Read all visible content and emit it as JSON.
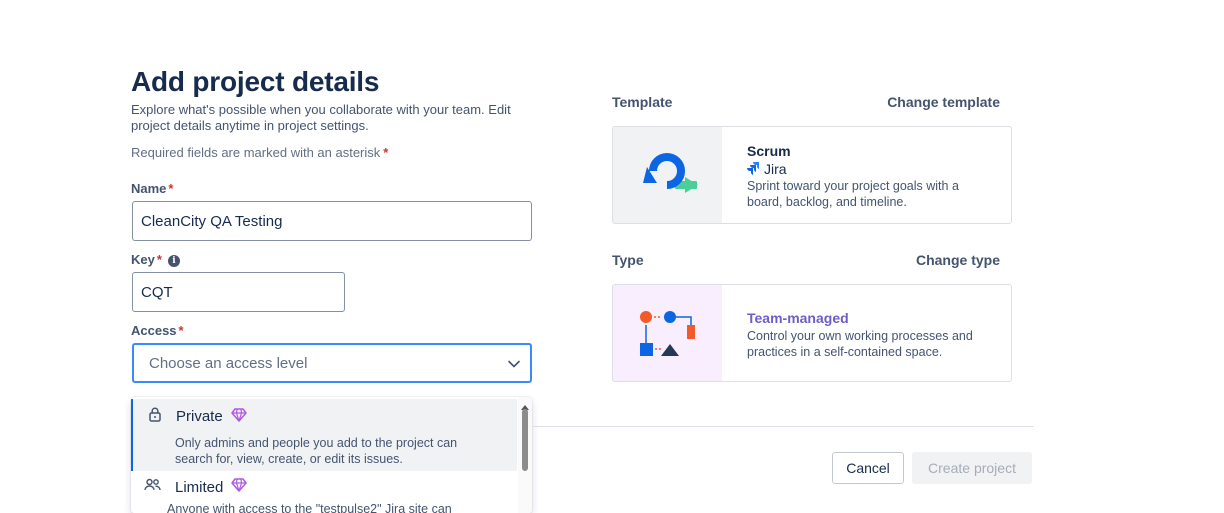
{
  "page": {
    "title": "Add project details",
    "description": "Explore what's possible when you collaborate with your team. Edit project details anytime in project settings.",
    "required_note": "Required fields are marked with an asterisk",
    "asterisk": "*"
  },
  "form": {
    "name": {
      "label": "Name",
      "value": "CleanCity QA Testing"
    },
    "key": {
      "label": "Key",
      "value": "CQT",
      "info_icon": "info-icon"
    },
    "access": {
      "label": "Access",
      "placeholder": "Choose an access level",
      "options": [
        {
          "title": "Private",
          "description": "Only admins and people you add to the project can search for, view, create, or edit its issues.",
          "icon": "lock-icon",
          "badge_icon": "premium-gem-icon"
        },
        {
          "title": "Limited",
          "description": "Anyone with access to the \"testpulse2\" Jira site can",
          "icon": "people-icon",
          "badge_icon": "premium-gem-icon"
        }
      ]
    }
  },
  "template": {
    "section_label": "Template",
    "change_label": "Change template",
    "name": "Scrum",
    "product": "Jira",
    "description": "Sprint toward your project goals with a board, backlog, and timeline."
  },
  "type": {
    "section_label": "Type",
    "change_label": "Change type",
    "name": "Team-managed",
    "description": "Control your own working processes and practices in a self-contained space."
  },
  "actions": {
    "cancel": "Cancel",
    "create": "Create project"
  },
  "colors": {
    "accent_blue": "#0c66e4",
    "focus_blue": "#388bff",
    "required_red": "#c9372c",
    "team_purple": "#6e5dc6",
    "gem_purple": "#af59e1"
  }
}
